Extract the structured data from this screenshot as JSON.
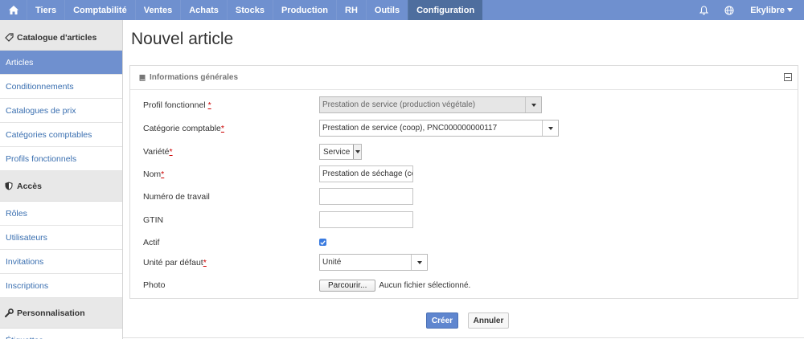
{
  "topbar": {
    "nav": [
      "Tiers",
      "Comptabilité",
      "Ventes",
      "Achats",
      "Stocks",
      "Production",
      "RH",
      "Outils",
      "Configuration"
    ],
    "active": "Configuration",
    "user": "Ekylibre"
  },
  "sidebar": {
    "sections": [
      {
        "title": "Catalogue d'articles",
        "icon": "tag-icon",
        "items": [
          "Articles",
          "Conditionnements",
          "Catalogues de prix",
          "Catégories comptables",
          "Profils fonctionnels"
        ]
      },
      {
        "title": "Accès",
        "icon": "shield-icon",
        "items": [
          "Rôles",
          "Utilisateurs",
          "Invitations",
          "Inscriptions"
        ]
      },
      {
        "title": "Personnalisation",
        "icon": "wrench-icon",
        "items": [
          "Étiquettes"
        ]
      }
    ],
    "active_item": "Articles"
  },
  "page": {
    "title": "Nouvel article"
  },
  "panel": {
    "title": "Informations générales"
  },
  "form": {
    "profil_label": "Profil fonctionnel",
    "profil_value": "Prestation de service (production végétale)",
    "categorie_label": "Catégorie comptable",
    "categorie_value": "Prestation de service (coop), PNC000000000117",
    "variete_label": "Variété",
    "variete_value": "Service",
    "nom_label": "Nom",
    "nom_value": "Prestation de séchage (coo",
    "numero_label": "Numéro de travail",
    "numero_value": "",
    "gtin_label": "GTIN",
    "gtin_value": "",
    "actif_label": "Actif",
    "actif_checked": true,
    "unite_label": "Unité par défaut",
    "unite_value": "Unité",
    "photo_label": "Photo",
    "photo_button": "Parcourir...",
    "photo_status": "Aucun fichier sélectionné.",
    "required_mark": "*"
  },
  "actions": {
    "create": "Créer",
    "cancel": "Annuler"
  },
  "colors": {
    "topbar": "#6f90cf",
    "topbar_active": "#4e6e9e",
    "sidebar_active": "#6f90cf",
    "primary_button": "#5f86cf",
    "link": "#3a6fb0"
  }
}
